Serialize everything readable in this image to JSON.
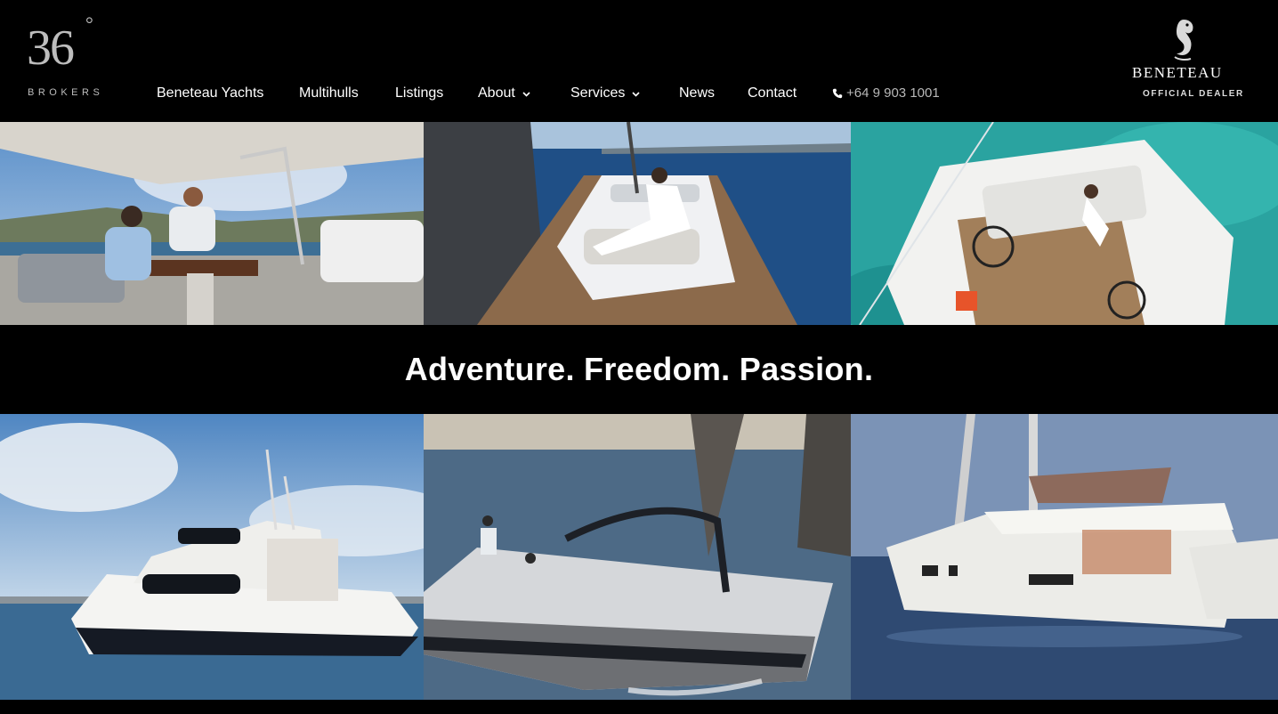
{
  "brand": {
    "logo_number": "36",
    "logo_degree": "°",
    "logo_sub": "BROKERS",
    "dealer_name": "Beneteau",
    "dealer_sub": "OFFICIAL DEALER"
  },
  "nav": {
    "items": [
      {
        "label": "Beneteau Yachts"
      },
      {
        "label": "Multihulls"
      },
      {
        "label": "Listings"
      },
      {
        "label": "About",
        "has_dropdown": true
      },
      {
        "label": "Services",
        "has_dropdown": true
      },
      {
        "label": "News"
      },
      {
        "label": "Contact"
      }
    ],
    "phone": "+64 9 903 1001"
  },
  "tagline": "Adventure. Freedom. Passion.",
  "icons": [
    "seahorse-icon",
    "chevron-down-icon",
    "phone-icon"
  ]
}
